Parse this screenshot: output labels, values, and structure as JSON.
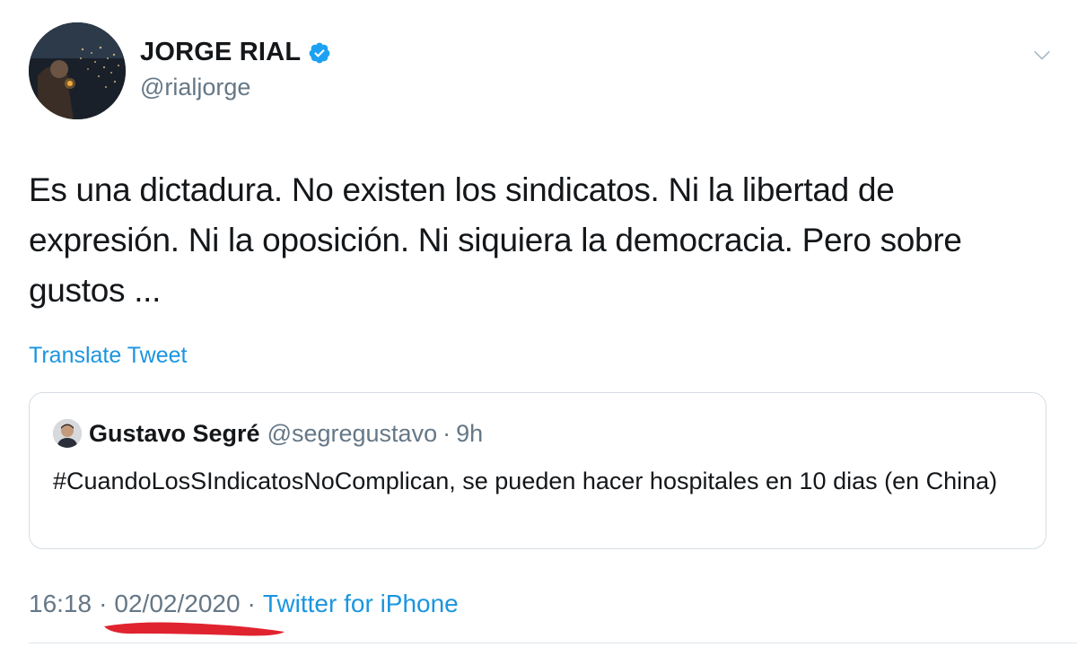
{
  "author": {
    "display_name": "JORGE RIAL",
    "handle": "@rialjorge",
    "verified": true,
    "verified_icon": "verified-badge-icon",
    "avatar_icon": "avatar"
  },
  "tweet": {
    "text": "Es una dictadura. No existen los sindicatos. Ni la libertad de expresión. Ni la oposición. Ni siquiera la democracia. Pero sobre gustos ...",
    "translate_label": "Translate Tweet"
  },
  "quoted_tweet": {
    "display_name": "Gustavo Segré",
    "handle": "@segregustavo",
    "separator": "·",
    "time": "9h",
    "text": "#CuandoLosSIndicatosNoComplican, se pueden hacer hospitales en 10 dias (en China)"
  },
  "meta": {
    "time": "16:18",
    "separator": "·",
    "date": "02/02/2020",
    "source": "Twitter for iPhone"
  },
  "colors": {
    "link": "#1b95e0",
    "secondary_text": "#657786",
    "primary_text": "#14171a",
    "annotation_underline": "#e0242f"
  }
}
